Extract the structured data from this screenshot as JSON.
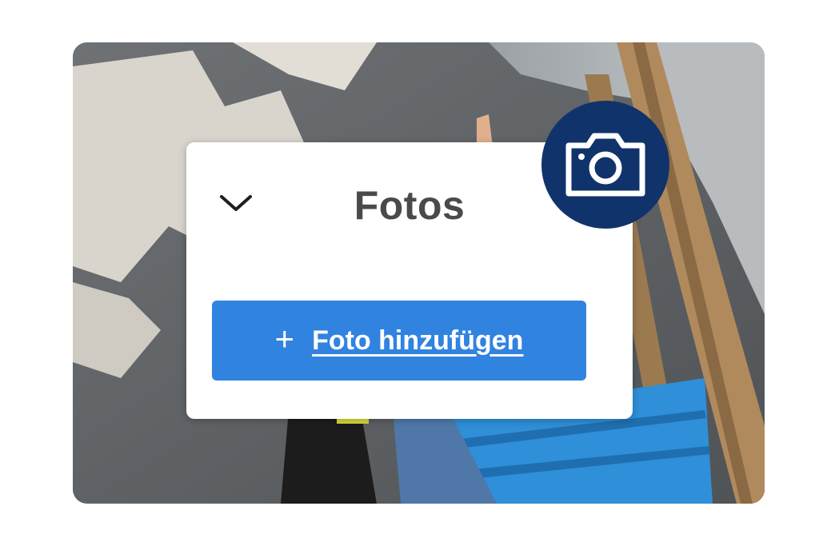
{
  "panel": {
    "title": "Fotos",
    "add_button_label": "Foto hinzufügen"
  },
  "icons": {
    "collapse": "chevron-down-icon",
    "add": "plus-icon",
    "badge": "camera-icon"
  },
  "colors": {
    "button": "#3183e0",
    "badge": "#11336b",
    "title": "#4a4a4a"
  }
}
